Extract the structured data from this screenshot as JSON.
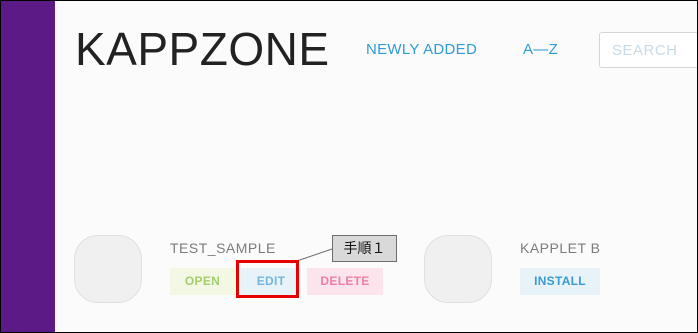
{
  "header": {
    "brand": "KAPPZONE",
    "nav": [
      {
        "label": "NEWLY ADDED"
      },
      {
        "label": "A—Z"
      }
    ],
    "search": {
      "placeholder": "SEARCH",
      "value": ""
    }
  },
  "apps": [
    {
      "name": "TEST_SAMPLE",
      "actions": [
        {
          "label": "OPEN"
        },
        {
          "label": "EDIT"
        },
        {
          "label": "DELETE"
        }
      ]
    },
    {
      "name": "KAPPLET B",
      "actions": [
        {
          "label": "INSTALL"
        }
      ]
    }
  ],
  "annotation": {
    "callout_label": "手順１",
    "highlight_color": "#e60000"
  },
  "colors": {
    "sidebar": "#5b1a86",
    "link": "#2e9ad6"
  }
}
